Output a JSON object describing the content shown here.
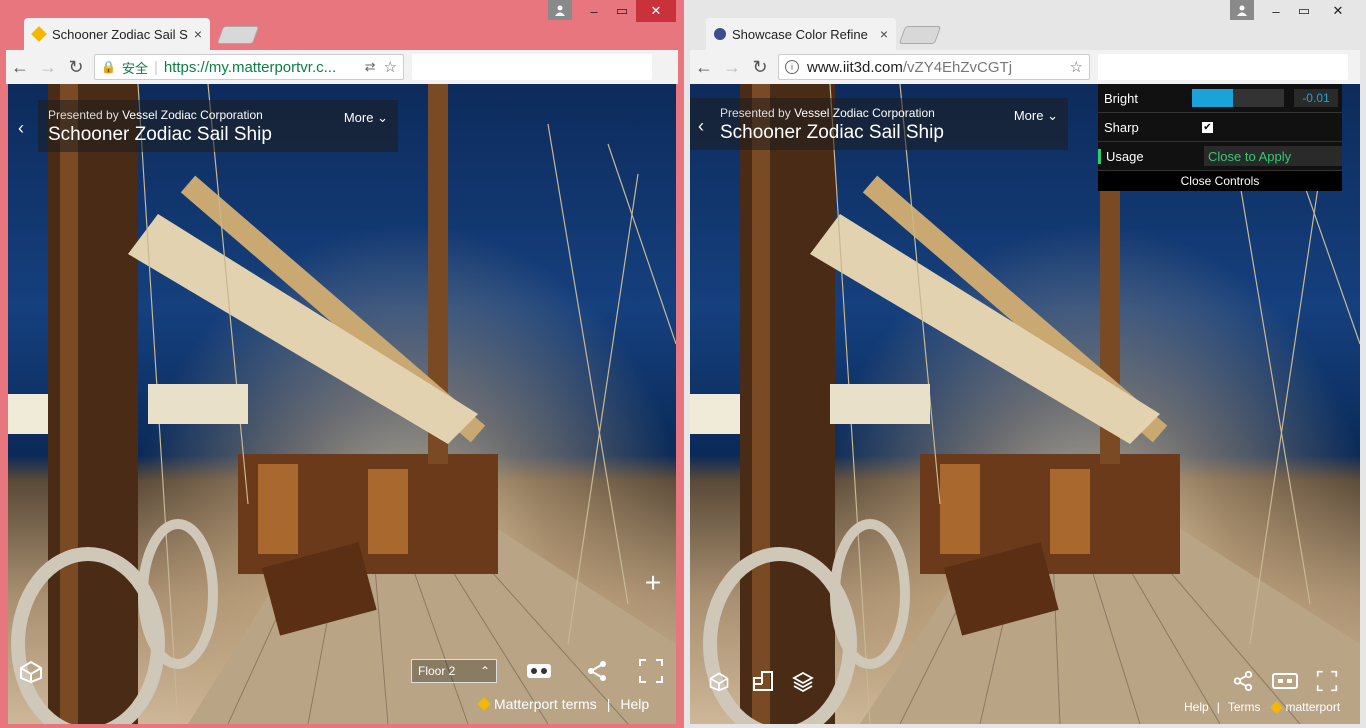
{
  "left_window": {
    "tab": {
      "title": "Schooner Zodiac Sail S",
      "close": "×"
    },
    "address": {
      "secure_label": "安全",
      "url": "https://my.matterportvr.c..."
    },
    "overlay": {
      "presented_prefix": "Presented by",
      "presenter": "Vessel Zodiac Corporation",
      "title": "Schooner Zodiac Sail Ship",
      "more_label": "More"
    },
    "floor_select": {
      "label": "Floor 2"
    },
    "footer": {
      "terms": "Matterport terms",
      "separator": "|",
      "help": "Help"
    }
  },
  "right_window": {
    "tab": {
      "title": "Showcase Color Refine",
      "close": "×"
    },
    "address": {
      "url_host": "www.iit3d.com",
      "url_path": "/vZY4EhZvCGTj"
    },
    "overlay": {
      "presented_prefix": "Presented by",
      "presenter": "Vessel Zodiac Corporation",
      "title": "Schooner Zodiac Sail Ship",
      "more_label": "More"
    },
    "color_controls": {
      "bright_label": "Bright",
      "bright_value": "-0.01",
      "bright_level": 0.45,
      "sharp_label": "Sharp",
      "sharp_checked": true,
      "usage_label": "Usage",
      "usage_value": "Close to Apply",
      "close_label": "Close Controls"
    },
    "footer": {
      "help": "Help",
      "separator": "|",
      "terms": "Terms",
      "brand": "matterport"
    }
  },
  "colors": {
    "left_frame": "#e8767f",
    "right_frame": "#e6e6e6",
    "close_button": "#c9313b",
    "slider_accent": "#1aa3d9",
    "usage_accent": "#2ecc71"
  },
  "icons": [
    "user-icon",
    "minimize-icon",
    "maximize-icon",
    "close-icon",
    "back-arrow-icon",
    "forward-arrow-icon",
    "reload-icon",
    "lock-icon",
    "info-icon",
    "translate-icon",
    "star-icon",
    "chevron-down-icon",
    "plus-icon",
    "dollhouse-icon",
    "vr-icon",
    "share-icon",
    "fullscreen-icon",
    "floorplan-icon",
    "floors-icon",
    "vr-headset-icon"
  ]
}
